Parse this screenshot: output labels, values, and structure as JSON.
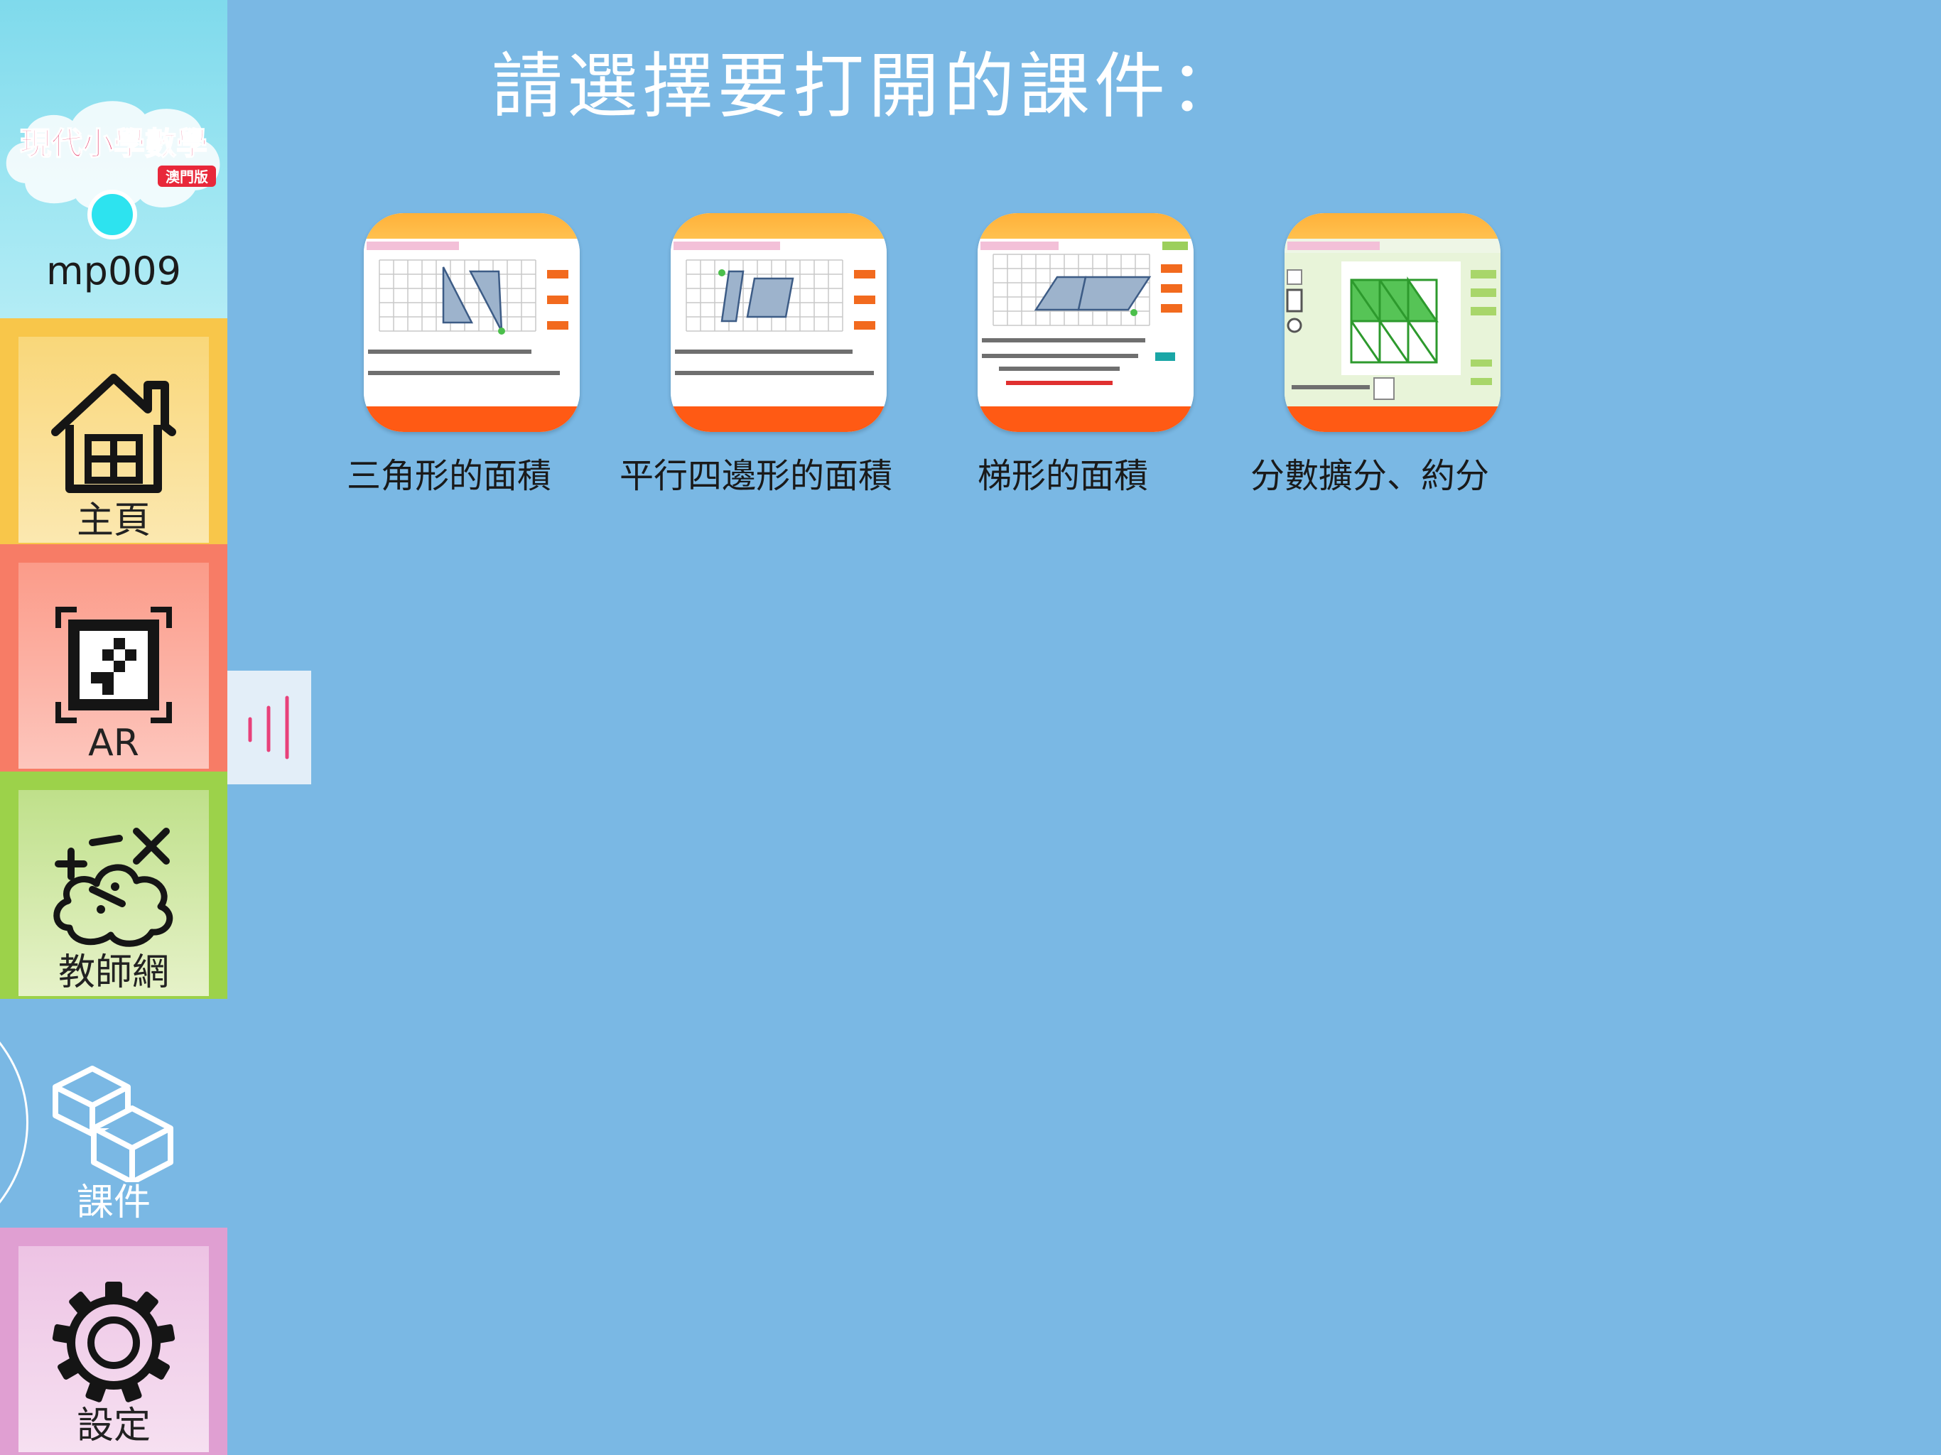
{
  "sidebar": {
    "username": "mp009",
    "logo_text": "現代小學數學",
    "logo_edition": "澳門版",
    "items": [
      {
        "label": "主頁",
        "icon": "home-icon"
      },
      {
        "label": "AR",
        "icon": "ar-marker-icon"
      },
      {
        "label": "教師網",
        "icon": "teacher-network-icon"
      },
      {
        "label": "課件",
        "icon": "courseware-cubes-icon",
        "active": true
      },
      {
        "label": "設定",
        "icon": "gear-icon"
      }
    ]
  },
  "main": {
    "title": "請選擇要打開的課件：",
    "courseware": [
      {
        "label": "三角形的面積"
      },
      {
        "label": "平行四邊形的面積"
      },
      {
        "label": "梯形的面積"
      },
      {
        "label": "分數擴分、約分"
      }
    ]
  },
  "colors": {
    "background": "#7ab8e4",
    "home": "#f8c64a",
    "ar": "#f77c66",
    "teacher": "#9cd24a",
    "settings": "#e09fd2",
    "thumb_top": "#ffb13a",
    "thumb_bottom": "#ff5a14"
  }
}
